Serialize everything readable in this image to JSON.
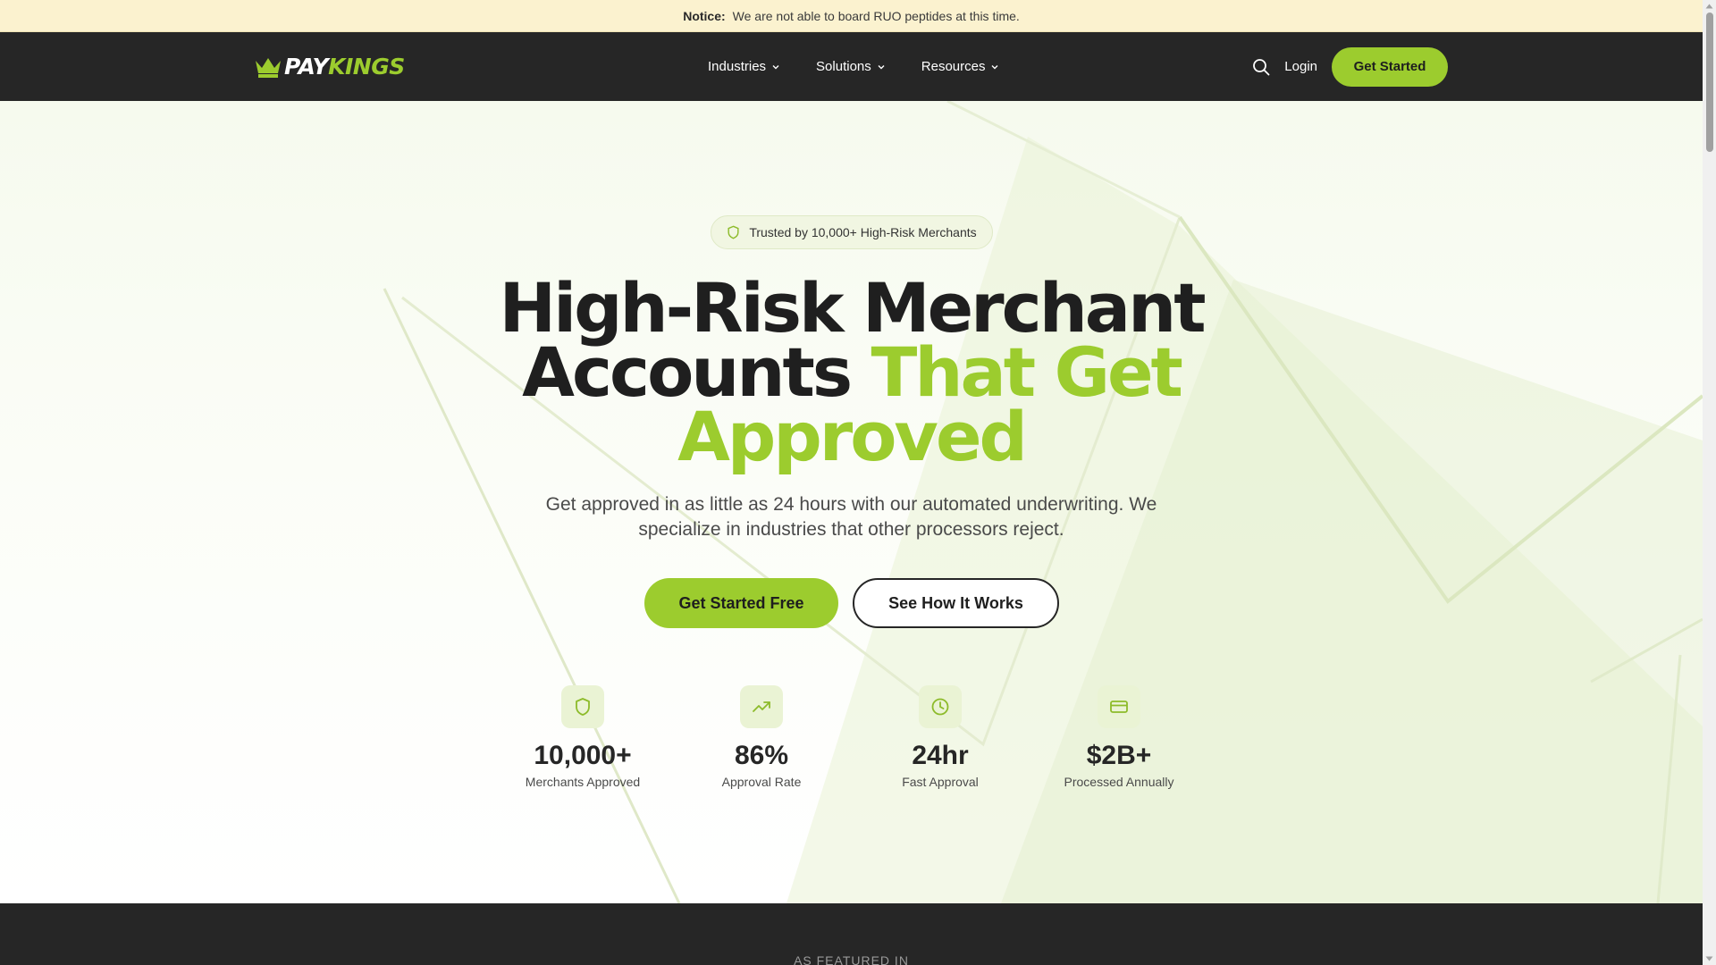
{
  "notice": {
    "label": "Notice:",
    "text": "We are not able to board RUO peptides at this time."
  },
  "nav": {
    "logo": {
      "part1": "PAY",
      "part2": "KINGS"
    },
    "menu": [
      {
        "label": "Industries"
      },
      {
        "label": "Solutions"
      },
      {
        "label": "Resources"
      }
    ],
    "login": "Login",
    "cta": "Get Started"
  },
  "hero": {
    "badge": "Trusted by 10,000+ High-Risk Merchants",
    "headline": {
      "line1": "High-Risk Merchant",
      "line2_plain": "Accounts ",
      "line2_green": "That Get",
      "line3_green": "Approved"
    },
    "subheadline": "Get approved in as little as 24 hours with our automated underwriting. We specialize in industries that other processors reject.",
    "primary_button": "Get Started Free",
    "secondary_button": "See How It Works",
    "stats": [
      {
        "icon": "shield-icon",
        "value": "10,000+",
        "label": "Merchants Approved"
      },
      {
        "icon": "trending-up-icon",
        "value": "86%",
        "label": "Approval Rate"
      },
      {
        "icon": "clock-icon",
        "value": "24hr",
        "label": "Fast Approval"
      },
      {
        "icon": "credit-card-icon",
        "value": "$2B+",
        "label": "Processed Annually"
      }
    ]
  },
  "featured": {
    "label": "AS FEATURED IN"
  },
  "colors": {
    "accent": "#9ccc2e",
    "dark": "#262626",
    "notice_bg": "#fbf2cf"
  }
}
